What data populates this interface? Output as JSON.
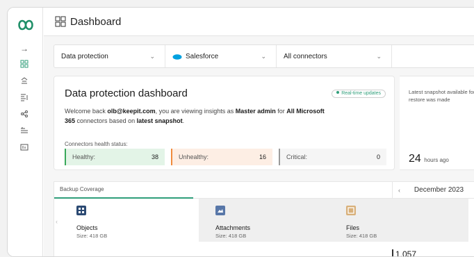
{
  "header": {
    "title": "Dashboard"
  },
  "filters": {
    "scope": "Data protection",
    "service": "Salesforce",
    "connectors": "All connectors"
  },
  "dashboard": {
    "title": "Data protection dashboard",
    "badge": "Real-time updates",
    "welcome_prefix": "Welcome back ",
    "user": "olb@keepit.com",
    "welcome_mid": ", you are viewing insights as ",
    "role": "Master admin",
    "welcome_for": " for ",
    "connectors_scope": "All Microsoft 365",
    "welcome_based": " connectors based on ",
    "snapshot": "latest snapshot",
    "welcome_end": ".",
    "health_label": "Connectors health status:",
    "health": [
      {
        "label": "Healthy:",
        "value": "38"
      },
      {
        "label": "Unhealthy:",
        "value": "16"
      },
      {
        "label": "Critical:",
        "value": "0"
      }
    ]
  },
  "snapshot": {
    "text": "Latest snapshot available for restore was made",
    "value": "24",
    "unit": "hours ago"
  },
  "coverage": {
    "label": "Backup Coverage",
    "month": "December 2023",
    "tiles": [
      {
        "name": "Objects",
        "size": "Size: 418 GB"
      },
      {
        "name": "Attachments",
        "size": "Size: 418 GB"
      },
      {
        "name": "Files",
        "size": "Size: 418 GB"
      }
    ],
    "partial_value": "1,057"
  },
  "colors": {
    "accent": "#2f9e7a",
    "healthy": "#39a85a",
    "unhealthy": "#f08b3c",
    "salesforce": "#00a1e0"
  }
}
